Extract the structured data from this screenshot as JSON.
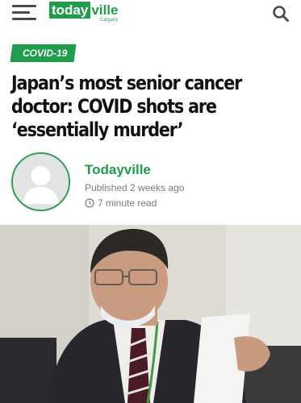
{
  "header": {
    "logo_main": "today",
    "logo_accent": "ville",
    "logo_sub": "Calgary",
    "menu_icon": "hamburger-menu-icon",
    "search_icon": "search-icon"
  },
  "article": {
    "category": "COVID-19",
    "headline": "Japan’s most senior cancer doctor: COVID shots are ‘essentially murder’",
    "author": "Todayville",
    "published": "Published 2 weeks ago",
    "read_time": "7 minute read",
    "clock_icon": "clock-icon"
  },
  "colors": {
    "brand_green": "#1e9e4a",
    "text_dark": "#111111",
    "meta_gray": "#7a7a7a"
  }
}
